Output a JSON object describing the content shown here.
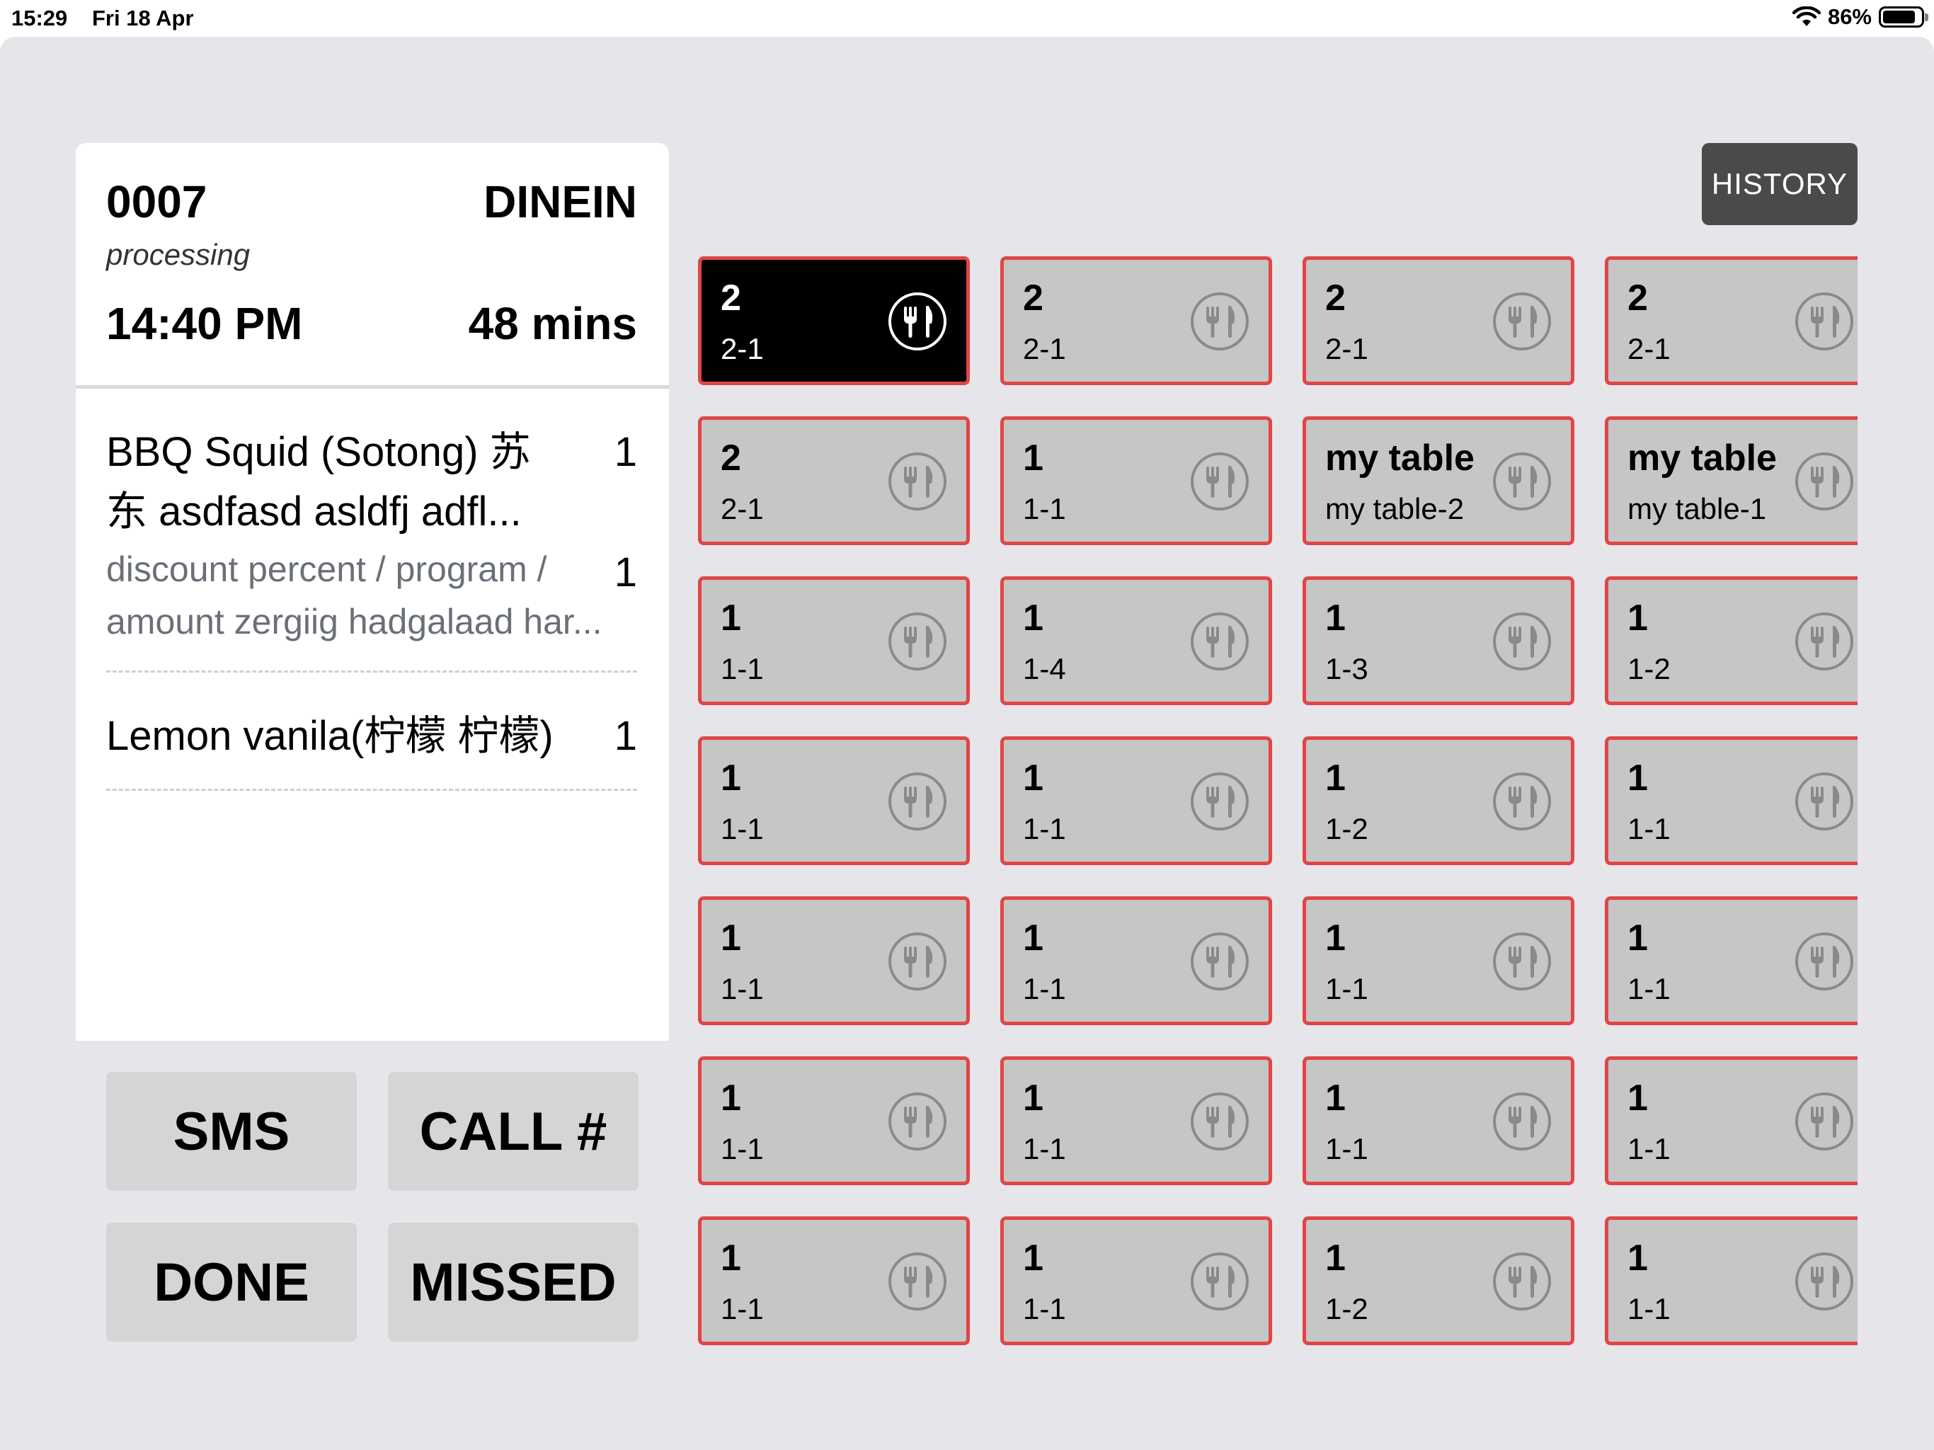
{
  "status_bar": {
    "time": "15:29",
    "date": "Fri 18 Apr",
    "battery": "86%",
    "battery_level": 0.86
  },
  "order": {
    "number": "0007",
    "type": "DINEIN",
    "status": "processing",
    "time": "14:40 PM",
    "elapsed": "48 mins",
    "items": [
      {
        "name": "BBQ Squid (Sotong) 苏东 asdfasd asldfj adfl...",
        "qty": "1",
        "modifier": "discount percent / program / amount zergiig hadgalaad har...",
        "modifier_qty": "1"
      },
      {
        "name": "Lemon vanila(柠檬 柠檬)",
        "qty": "1"
      }
    ]
  },
  "actions": {
    "sms": "SMS",
    "call": "CALL #",
    "done": "DONE",
    "missed": "MISSED"
  },
  "history_label": "HISTORY",
  "colors": {
    "tile_border": "#e24545",
    "tile_bg": "#c6c6c6",
    "tile_selected_bg": "#000000",
    "history_bg": "#4a4a4a",
    "app_bg": "#e6e6ea"
  },
  "tables": [
    {
      "title": "2",
      "sub": "2-1",
      "selected": true,
      "icon": "utensils-icon"
    },
    {
      "title": "2",
      "sub": "2-1",
      "selected": false,
      "icon": "utensils-icon"
    },
    {
      "title": "2",
      "sub": "2-1",
      "selected": false,
      "icon": "utensils-icon"
    },
    {
      "title": "2",
      "sub": "2-1",
      "selected": false,
      "icon": "utensils-icon"
    },
    {
      "title": "2",
      "sub": "2-1",
      "selected": false,
      "icon": "utensils-icon"
    },
    {
      "title": "1",
      "sub": "1-1",
      "selected": false,
      "icon": "utensils-icon"
    },
    {
      "title": "my table",
      "sub": "my table-2",
      "selected": false,
      "icon": "utensils-icon"
    },
    {
      "title": "my table",
      "sub": "my table-1",
      "selected": false,
      "icon": "utensils-icon"
    },
    {
      "title": "1",
      "sub": "1-1",
      "selected": false,
      "icon": "utensils-icon"
    },
    {
      "title": "1",
      "sub": "1-4",
      "selected": false,
      "icon": "utensils-icon"
    },
    {
      "title": "1",
      "sub": "1-3",
      "selected": false,
      "icon": "utensils-icon"
    },
    {
      "title": "1",
      "sub": "1-2",
      "selected": false,
      "icon": "utensils-icon"
    },
    {
      "title": "1",
      "sub": "1-1",
      "selected": false,
      "icon": "utensils-icon"
    },
    {
      "title": "1",
      "sub": "1-1",
      "selected": false,
      "icon": "utensils-icon"
    },
    {
      "title": "1",
      "sub": "1-2",
      "selected": false,
      "icon": "utensils-icon"
    },
    {
      "title": "1",
      "sub": "1-1",
      "selected": false,
      "icon": "utensils-icon"
    },
    {
      "title": "1",
      "sub": "1-1",
      "selected": false,
      "icon": "utensils-icon"
    },
    {
      "title": "1",
      "sub": "1-1",
      "selected": false,
      "icon": "utensils-icon"
    },
    {
      "title": "1",
      "sub": "1-1",
      "selected": false,
      "icon": "utensils-icon"
    },
    {
      "title": "1",
      "sub": "1-1",
      "selected": false,
      "icon": "utensils-icon"
    },
    {
      "title": "1",
      "sub": "1-1",
      "selected": false,
      "icon": "utensils-icon"
    },
    {
      "title": "1",
      "sub": "1-1",
      "selected": false,
      "icon": "utensils-icon"
    },
    {
      "title": "1",
      "sub": "1-1",
      "selected": false,
      "icon": "utensils-icon"
    },
    {
      "title": "1",
      "sub": "1-1",
      "selected": false,
      "icon": "utensils-icon"
    },
    {
      "title": "1",
      "sub": "1-1",
      "selected": false,
      "icon": "utensils-icon"
    },
    {
      "title": "1",
      "sub": "1-1",
      "selected": false,
      "icon": "utensils-icon"
    },
    {
      "title": "1",
      "sub": "1-2",
      "selected": false,
      "icon": "utensils-icon"
    },
    {
      "title": "1",
      "sub": "1-1",
      "selected": false,
      "icon": "utensils-icon"
    }
  ]
}
